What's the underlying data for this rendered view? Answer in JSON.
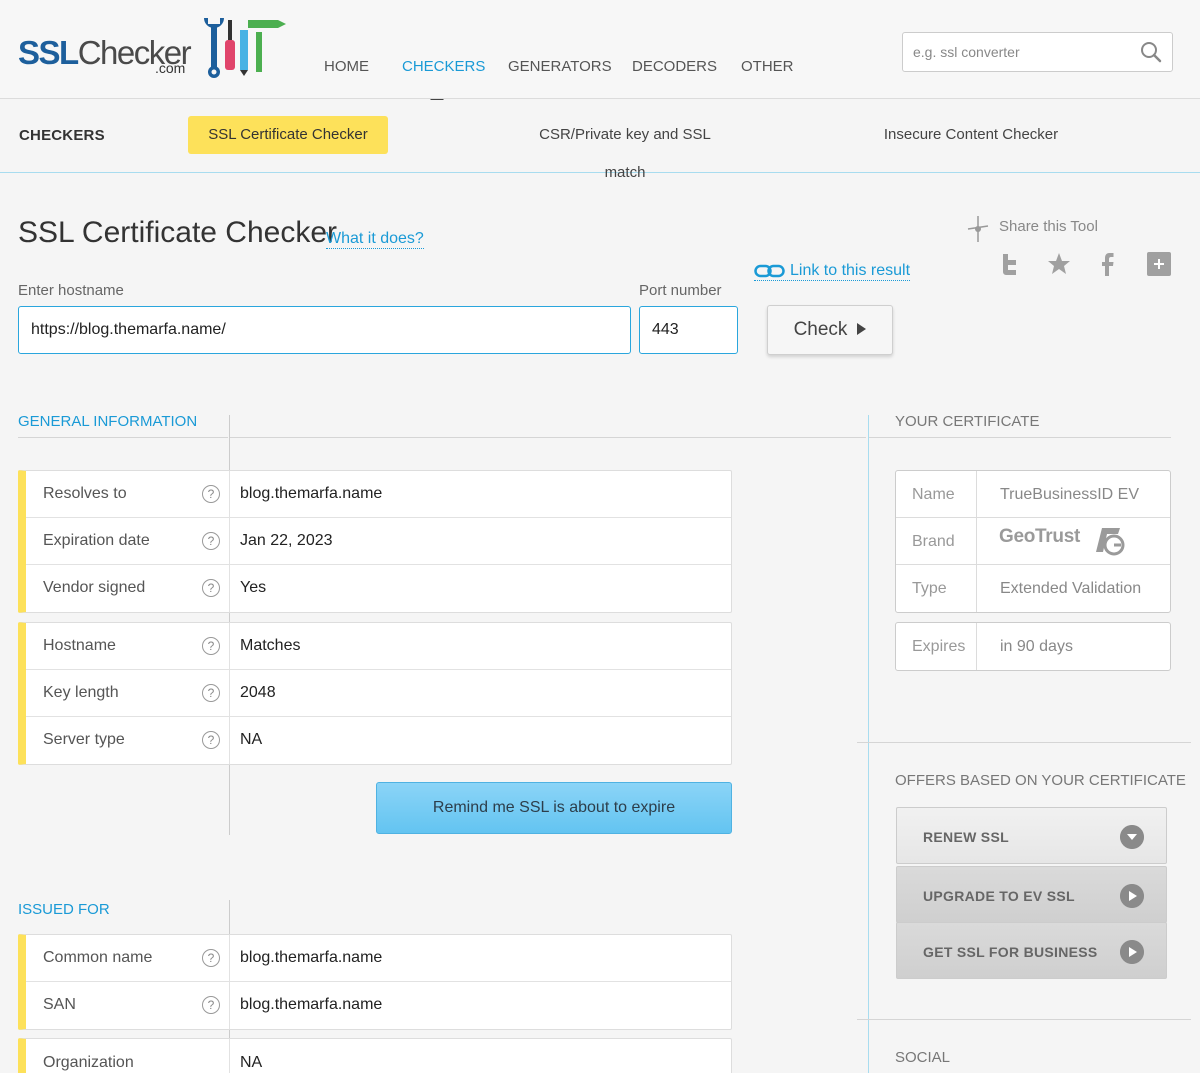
{
  "header": {
    "logo_text_ssl": "SSL",
    "logo_text_checker": "Checker",
    "logo_dotcom": ".com",
    "nav": [
      {
        "label": "HOME"
      },
      {
        "label": "CHECKERS"
      },
      {
        "label": "GENERATORS"
      },
      {
        "label": "DECODERS"
      },
      {
        "label": "OTHER"
      }
    ],
    "search_placeholder": "e.g. ssl converter"
  },
  "subnav": {
    "title": "CHECKERS",
    "items": [
      {
        "label": "SSL Certificate Checker"
      },
      {
        "label": "CSR/Private key and SSL match"
      },
      {
        "label": "Insecure Content Checker"
      }
    ]
  },
  "main": {
    "title": "SSL Certificate Checker",
    "what_link": "What it does?",
    "result_link": "Link to this result",
    "share_label": "Share this Tool",
    "hostname_label": "Enter hostname",
    "hostname_value": "https://blog.themarfa.name/",
    "port_label": "Port number",
    "port_value": "443",
    "check_label": "Check"
  },
  "general": {
    "heading": "GENERAL INFORMATION",
    "group1": [
      {
        "label": "Resolves to",
        "value": "blog.themarfa.name"
      },
      {
        "label": "Expiration date",
        "value": "Jan 22, 2023"
      },
      {
        "label": "Vendor signed",
        "value": "Yes"
      }
    ],
    "group2": [
      {
        "label": "Hostname",
        "value": "Matches"
      },
      {
        "label": "Key length",
        "value": "2048"
      },
      {
        "label": "Server type",
        "value": "NA"
      }
    ],
    "remind_label": "Remind me SSL is about to expire"
  },
  "issued": {
    "heading": "ISSUED FOR",
    "group1": [
      {
        "label": "Common name",
        "value": "blog.themarfa.name"
      },
      {
        "label": "SAN",
        "value": "blog.themarfa.name"
      }
    ],
    "group2": [
      {
        "label": "Organization",
        "value": "NA"
      }
    ]
  },
  "certificate": {
    "heading": "YOUR CERTIFICATE",
    "rows": [
      {
        "label": "Name",
        "value": "TrueBusinessID EV"
      },
      {
        "label": "Brand",
        "value": "GeoTrust"
      },
      {
        "label": "Type",
        "value": "Extended Validation"
      }
    ],
    "expires": {
      "label": "Expires",
      "value": "in 90 days"
    }
  },
  "offers": {
    "heading": "OFFERS BASED ON YOUR CERTIFICATE",
    "items": [
      {
        "label": "RENEW SSL",
        "icon": "chevron-down-icon"
      },
      {
        "label": "UPGRADE TO EV SSL",
        "icon": "play-icon"
      },
      {
        "label": "GET SSL FOR BUSINESS",
        "icon": "play-icon"
      }
    ]
  },
  "social": {
    "heading": "SOCIAL"
  },
  "colors": {
    "accent": "#1a9ad6",
    "highlight": "#fde15a",
    "button_blue": "#6cc8f3"
  }
}
